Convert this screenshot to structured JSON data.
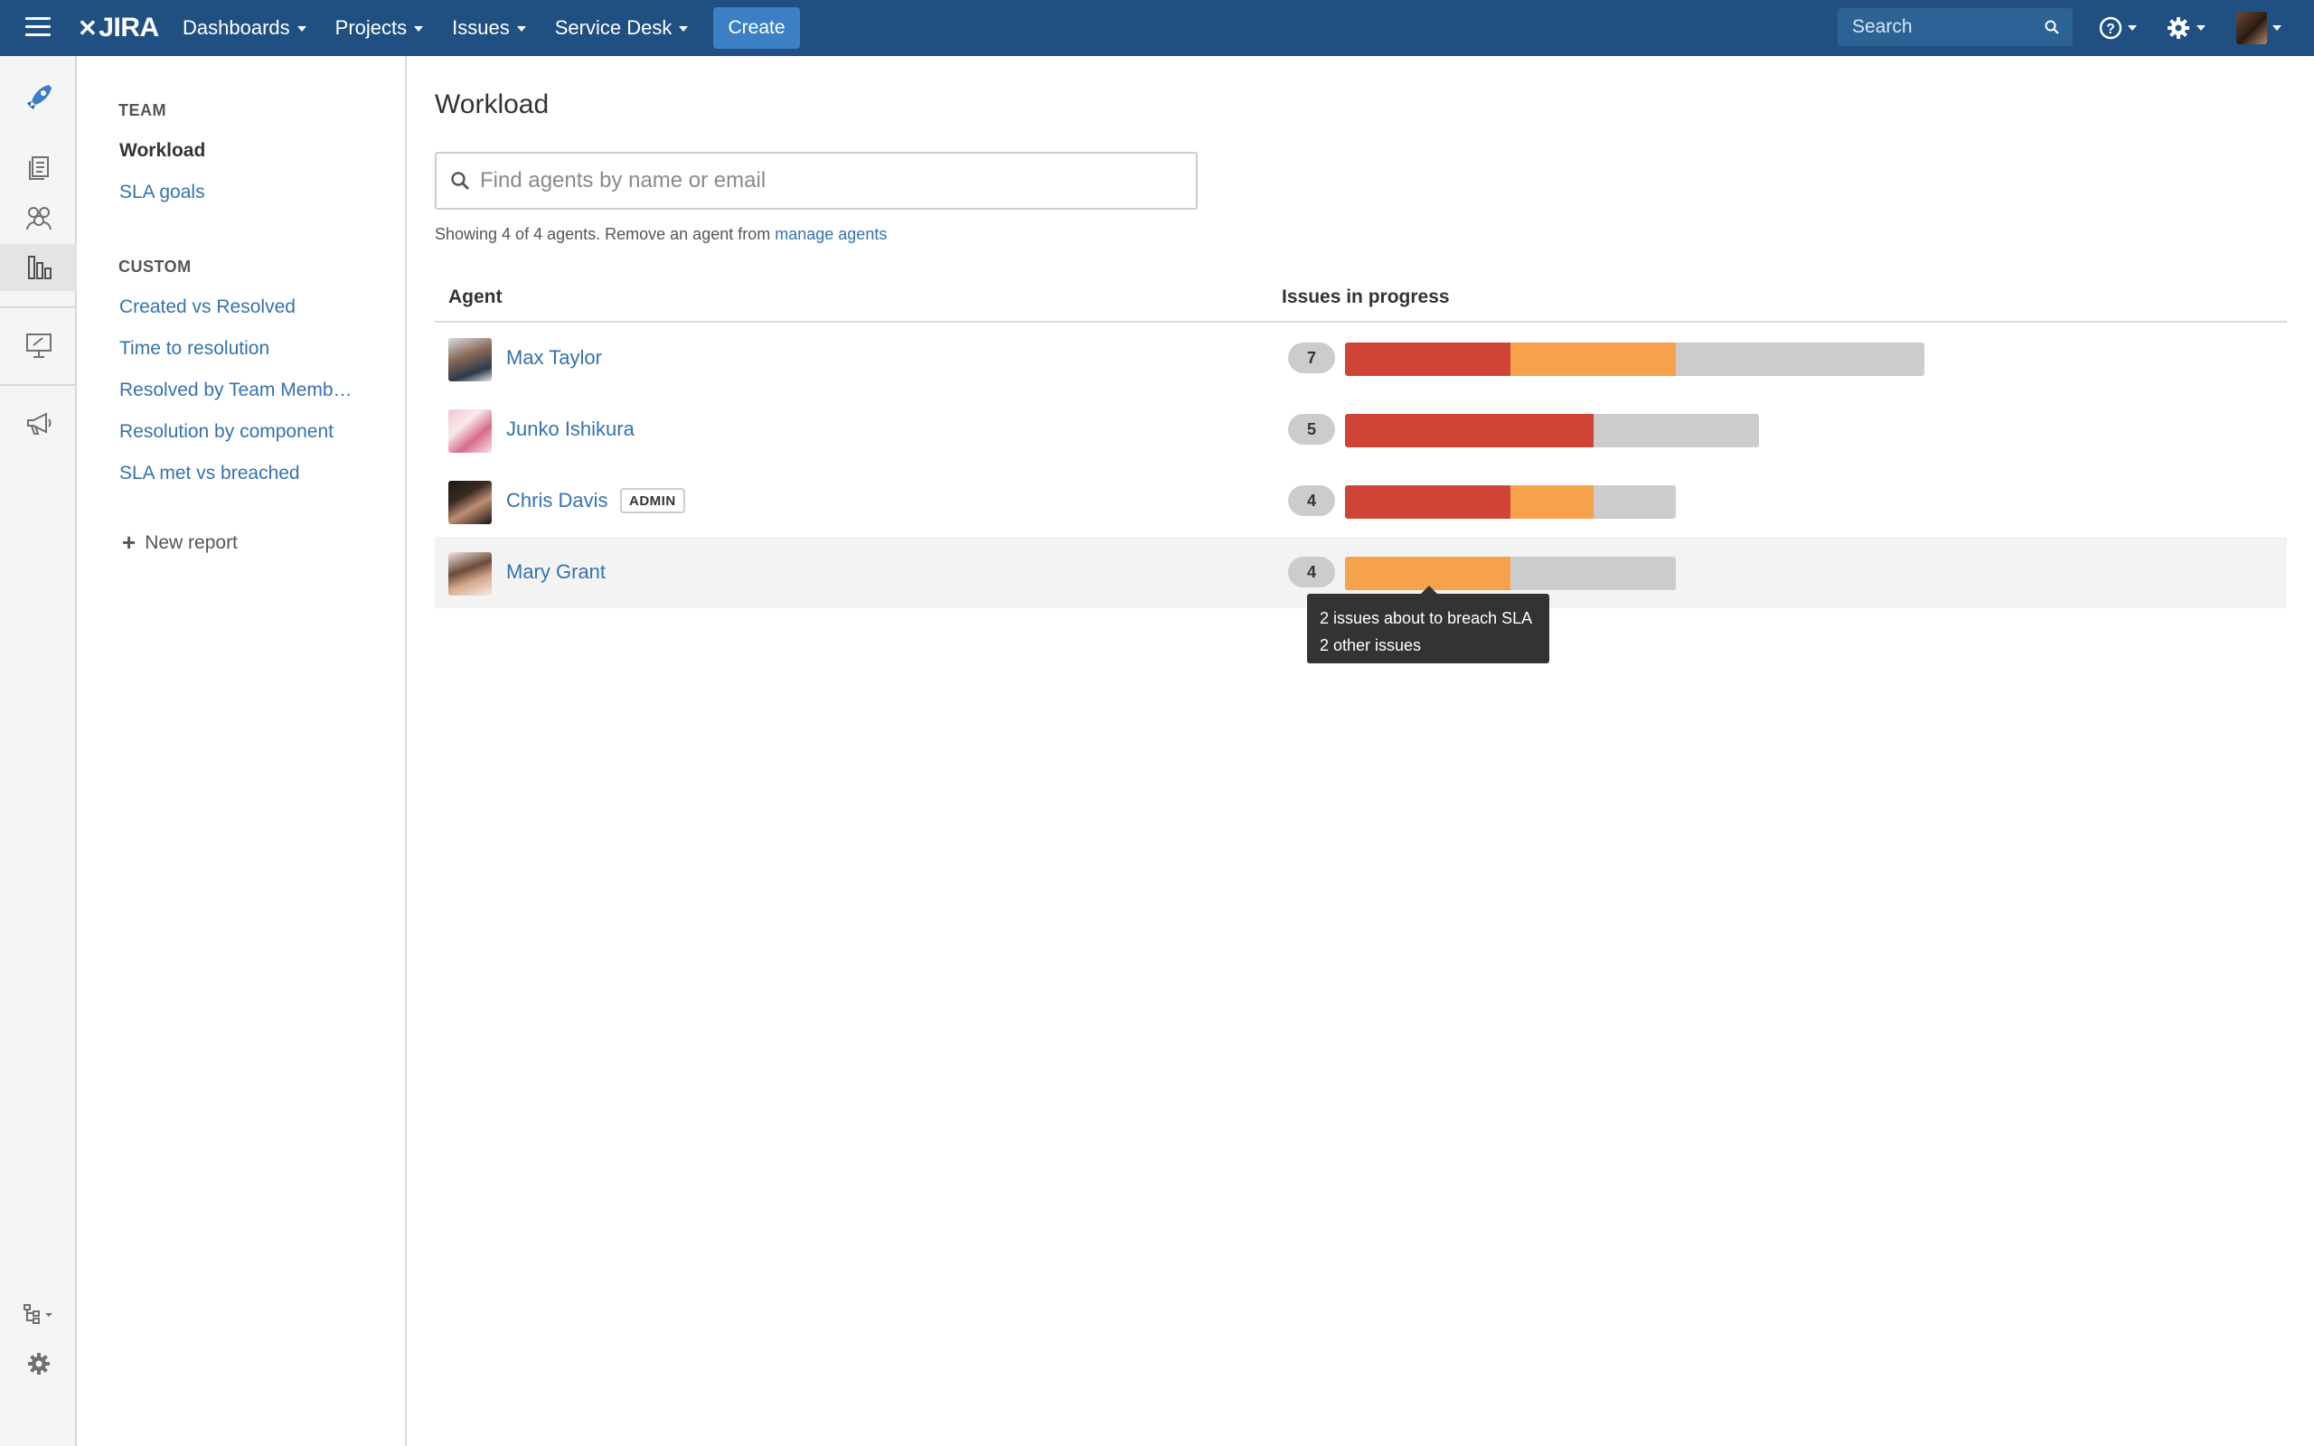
{
  "header": {
    "logo": "JIRA",
    "menus": [
      {
        "label": "Dashboards"
      },
      {
        "label": "Projects"
      },
      {
        "label": "Issues"
      },
      {
        "label": "Service Desk"
      }
    ],
    "create_label": "Create",
    "search_placeholder": "Search",
    "brand_color": "#205081"
  },
  "rail": {
    "icons": [
      "rocket-icon",
      "queues-icon",
      "customers-icon",
      "reports-icon",
      "presentation-icon",
      "megaphone-icon",
      "shortcuts-icon",
      "settings-icon"
    ],
    "active": "reports-icon"
  },
  "sidebar": {
    "team_heading": "TEAM",
    "team_items": [
      {
        "label": "Workload",
        "current": true
      },
      {
        "label": "SLA goals",
        "current": false
      }
    ],
    "custom_heading": "CUSTOM",
    "custom_items": [
      {
        "label": "Created vs Resolved"
      },
      {
        "label": "Time to resolution"
      },
      {
        "label": "Resolved by Team Memb…"
      },
      {
        "label": "Resolution by component"
      },
      {
        "label": "SLA met vs breached"
      }
    ],
    "new_report_label": "New report"
  },
  "main": {
    "title": "Workload",
    "search_placeholder": "Find agents by name or email",
    "showing_text": "Showing 4 of 4 agents. Remove an agent from ",
    "manage_link": "manage agents",
    "columns": {
      "agent": "Agent",
      "issues": "Issues in progress"
    },
    "colors": {
      "breached": "#d04437",
      "about_to_breach": "#f6a24c",
      "other": "#cccccc"
    },
    "agents": [
      {
        "name": "Max Taylor",
        "badge": "",
        "count": "7",
        "breached": 2,
        "about_to_breach": 2,
        "other": 3
      },
      {
        "name": "Junko Ishikura",
        "badge": "",
        "count": "5",
        "breached": 3,
        "about_to_breach": 0,
        "other": 2
      },
      {
        "name": "Chris Davis",
        "badge": "ADMIN",
        "count": "4",
        "breached": 2,
        "about_to_breach": 1,
        "other": 1
      },
      {
        "name": "Mary Grant",
        "badge": "",
        "count": "4",
        "breached": 0,
        "about_to_breach": 2,
        "other": 2
      }
    ],
    "tooltip": {
      "line1": "2 issues about to breach SLA",
      "line2": "2 other issues"
    }
  }
}
